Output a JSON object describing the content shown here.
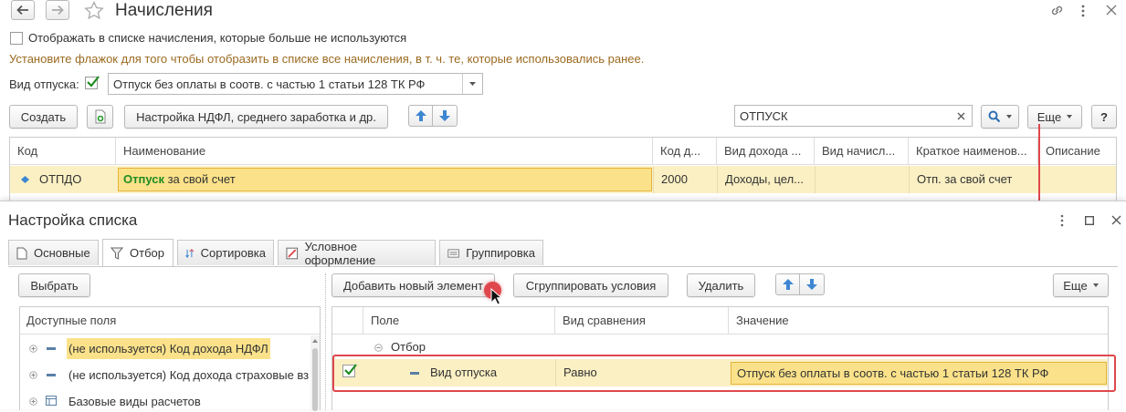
{
  "window": {
    "title": "Начисления"
  },
  "options": {
    "show_unused_label": "Отображать в списке начисления, которые больше не используются",
    "hint": "Установите флажок для того чтобы отобразить в списке все начисления, в т. ч. те, которые использовались ранее.",
    "leave_type_label": "Вид отпуска:",
    "leave_type_value": "Отпуск без оплаты в соотв. с частью 1 статьи 128 ТК РФ"
  },
  "toolbar": {
    "create_label": "Создать",
    "ndfl_settings_label": "Настройка НДФЛ, среднего заработка и др.",
    "search_value": "ОТПУСК",
    "more_label": "Еще",
    "help_label": "?"
  },
  "table": {
    "columns": [
      "Код",
      "Наименование",
      "Код д...",
      "Вид дохода ...",
      "Вид начисл...",
      "Краткое наименов...",
      "Описание"
    ],
    "row": {
      "code": "ОТПДО",
      "name_highlight": "Отпуск",
      "name_rest": " за свой счет",
      "income_code": "2000",
      "income_type": "Доходы, цел...",
      "accrual_type": "",
      "short_name": "Отп. за свой счет",
      "description": ""
    }
  },
  "dialog": {
    "title": "Настройка списка",
    "tabs": [
      "Основные",
      "Отбор",
      "Сортировка",
      "Условное оформление",
      "Группировка"
    ],
    "select_label": "Выбрать",
    "available_fields_header": "Доступные поля",
    "fields": [
      {
        "label": "(не используется) Код дохода НДФЛ"
      },
      {
        "label": "(не используется) Код дохода страховые вз"
      },
      {
        "label": "Базовые виды расчетов"
      }
    ],
    "add_element_label": "Добавить новый элемент",
    "group_conditions_label": "Сгруппировать условия",
    "delete_label": "Удалить",
    "more_label": "Еще",
    "filter_columns": [
      "Поле",
      "Вид сравнения",
      "Значение"
    ],
    "filter_group": "Отбор",
    "filter_row": {
      "field": "Вид отпуска",
      "comparison": "Равно",
      "value": "Отпуск без оплаты в соотв. с частью 1 статьи 128 ТК РФ"
    }
  },
  "colors": {
    "selected_row": "#fbf0c3",
    "highlight_box": "#fbe28a",
    "hint_text": "#9b6a21",
    "annotation_red": "#e0474c",
    "search_highlight": "#1f8b22",
    "arrow_blue": "#3d86d2"
  }
}
